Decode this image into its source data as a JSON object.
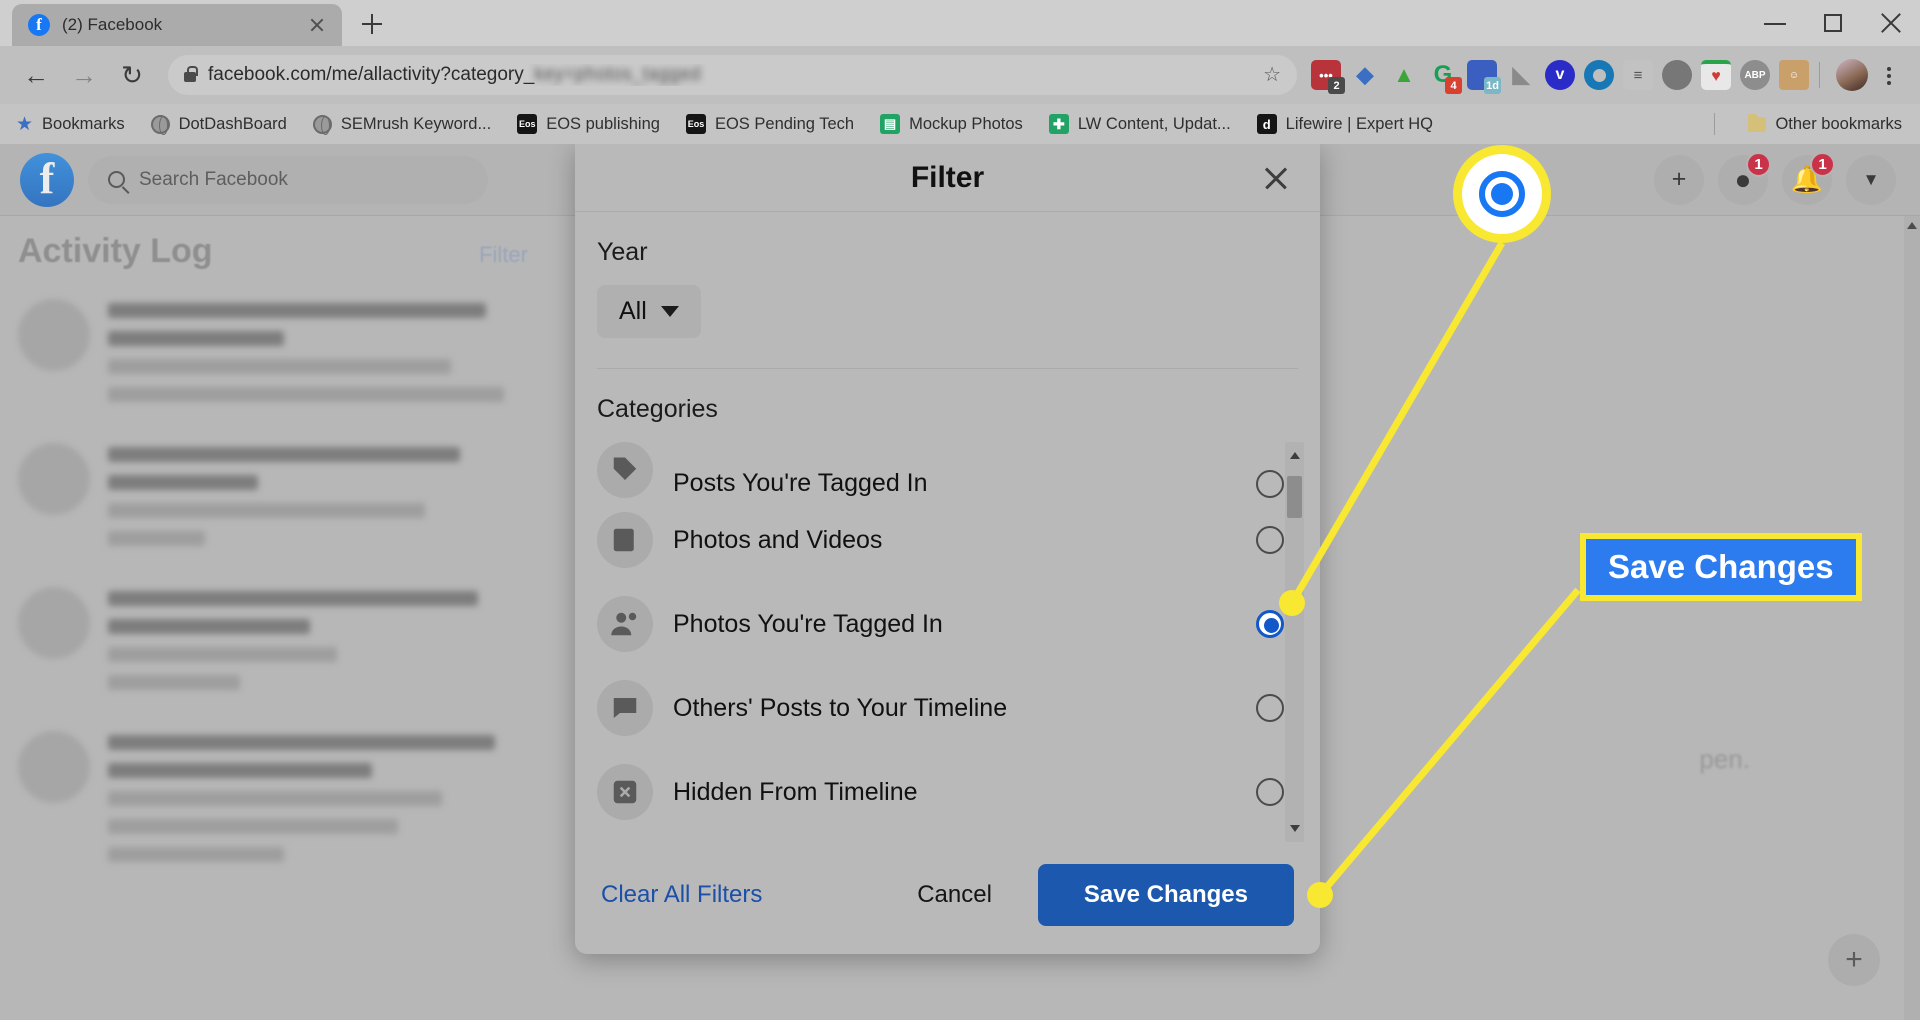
{
  "browser": {
    "tab": {
      "title": "(2) Facebook",
      "favicon": "facebook-favicon"
    },
    "new_tab_label": "+",
    "window_controls": {
      "minimize": "minimize",
      "maximize": "maximize",
      "close": "close"
    },
    "nav": {
      "back": "←",
      "forward": "→",
      "reload": "↻"
    },
    "url": {
      "visible": "facebook.com/me/allactivity?category_",
      "blurred_tail": "key=photos_tagged"
    },
    "extensions": [
      {
        "name": "lastpass-extension",
        "label": "",
        "badge": "2",
        "color": "#b8333a",
        "badge_color": "#4a4a4a"
      },
      {
        "name": "yoast-extension",
        "label": "",
        "badge": "",
        "color": "#5ea8e0"
      },
      {
        "name": "evernote-extension",
        "label": "",
        "badge": "",
        "color": "#3aa63a"
      },
      {
        "name": "grammarly-extension",
        "label": "",
        "badge": "4",
        "color": "#1a9e52",
        "badge_color": "#d8402f"
      },
      {
        "name": "onedrive-extension",
        "label": "1d",
        "badge": "",
        "color": "#3b5fc0"
      },
      {
        "name": "pocket-extension",
        "label": "",
        "badge": "",
        "color": "#8a8a8a"
      },
      {
        "name": "vimeo-extension",
        "label": "v",
        "badge": "",
        "color": "#2b2bc8"
      },
      {
        "name": "opera-extension",
        "label": "",
        "badge": "",
        "color": "#1877b5"
      },
      {
        "name": "calculator-extension",
        "label": "",
        "badge": "",
        "color": "#9a9a9a"
      },
      {
        "name": "moon-extension",
        "label": "",
        "badge": "",
        "color": "#777777"
      },
      {
        "name": "tomato-timer-extension",
        "label": "",
        "badge": "",
        "color": "#d03a36"
      },
      {
        "name": "adblock-plus-extension",
        "label": "ABP",
        "badge": "",
        "color": "#8d8d8d"
      },
      {
        "name": "honey-extension",
        "label": "",
        "badge": "",
        "color": "#c9a06a"
      }
    ],
    "bookmarks": [
      {
        "label": "Bookmarks",
        "icon": "star-icon"
      },
      {
        "label": "DotDashBoard",
        "icon": "globe-icon"
      },
      {
        "label": "SEMrush Keyword...",
        "icon": "globe-icon"
      },
      {
        "label": "EOS publishing",
        "icon": "eos-icon"
      },
      {
        "label": "EOS Pending Tech",
        "icon": "eos-icon"
      },
      {
        "label": "Mockup Photos",
        "icon": "sheets-icon"
      },
      {
        "label": "LW Content, Updat...",
        "icon": "sheets-icon"
      },
      {
        "label": "Lifewire | Expert HQ",
        "icon": "dotdash-icon"
      }
    ],
    "other_bookmarks": "Other bookmarks"
  },
  "facebook": {
    "search_placeholder": "Search Facebook",
    "logo": "facebook-logo",
    "header_actions": [
      {
        "name": "create-button",
        "glyph": "+",
        "badge": ""
      },
      {
        "name": "messenger-button",
        "glyph": "●",
        "badge": "1"
      },
      {
        "name": "notifications-button",
        "glyph": "●",
        "badge": "1"
      },
      {
        "name": "account-menu-button",
        "glyph": "▼",
        "badge": ""
      }
    ],
    "activity_log_title": "Activity Log",
    "filter_link": "Filter"
  },
  "modal": {
    "title": "Filter",
    "close_label": "close",
    "year": {
      "label": "Year",
      "value": "All"
    },
    "categories_label": "Categories",
    "categories": [
      {
        "label": "Posts You're Tagged In",
        "icon": "tag-icon",
        "selected": false,
        "clipped": true
      },
      {
        "label": "Photos and Videos",
        "icon": "photo-icon",
        "selected": false,
        "clipped": false
      },
      {
        "label": "Photos You're Tagged In",
        "icon": "person-tag-icon",
        "selected": true,
        "clipped": false
      },
      {
        "label": "Others' Posts to Your Timeline",
        "icon": "comment-icon",
        "selected": false,
        "clipped": false
      },
      {
        "label": "Hidden From Timeline",
        "icon": "hidden-icon",
        "selected": false,
        "clipped": false
      }
    ],
    "footer": {
      "clear_all": "Clear All Filters",
      "cancel": "Cancel",
      "save": "Save Changes"
    }
  },
  "annotations": {
    "callout_label": "Save Changes",
    "highlight_color": "#f8e831",
    "callout_bg": "#2c7cf0"
  }
}
